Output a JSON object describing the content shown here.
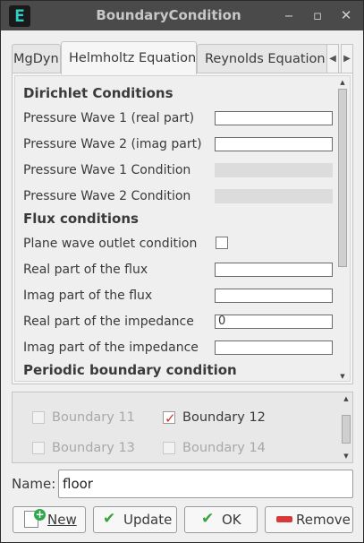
{
  "window": {
    "title": "BoundaryCondition",
    "app_icon": "E"
  },
  "titlebar_buttons": {
    "minimize": "‒",
    "maximize": "▫",
    "close": "✕"
  },
  "tabs": [
    {
      "label": "MgDyn",
      "active": false
    },
    {
      "label": "Helmholtz Equation",
      "active": true
    },
    {
      "label": "Reynolds Equation",
      "active": false
    }
  ],
  "tab_scroll": {
    "left": "◀",
    "right": "▶"
  },
  "helmholtz": {
    "dirichlet_title": "Dirichlet Conditions",
    "pw1_real_label": "Pressure Wave 1 (real part)",
    "pw1_real_value": "",
    "pw2_imag_label": "Pressure Wave 2 (imag part)",
    "pw2_imag_value": "",
    "pw1_cond_label": "Pressure Wave 1 Condition",
    "pw1_cond_value": "",
    "pw2_cond_label": "Pressure Wave 2 Condition",
    "pw2_cond_value": "",
    "flux_title": "Flux conditions",
    "plane_wave_label": "Plane wave outlet condition",
    "plane_wave_checked": false,
    "real_flux_label": "Real part of the flux",
    "real_flux_value": "",
    "imag_flux_label": "Imag part of the flux",
    "imag_flux_value": "",
    "real_imp_label": "Real part of the impedance",
    "real_imp_value": "0",
    "imag_imp_label": "Imag part of the impedance",
    "imag_imp_value": "",
    "periodic_title": "Periodic boundary condition"
  },
  "boundaries": [
    {
      "label": "Boundary 11",
      "checked": false
    },
    {
      "label": "Boundary 12",
      "checked": true
    },
    {
      "label": "Boundary 13",
      "checked": false
    },
    {
      "label": "Boundary 14",
      "checked": false
    }
  ],
  "name": {
    "label": "Name:",
    "value": "floor"
  },
  "buttons": {
    "new": "New",
    "update": "Update",
    "ok": "OK",
    "remove": "Remove"
  },
  "colors": {
    "titlebar": "#4a4a4a",
    "check_red": "#d03030",
    "check_green": "#3aa23a",
    "remove_red": "#d83838",
    "app_icon": "#2fd0c8"
  }
}
